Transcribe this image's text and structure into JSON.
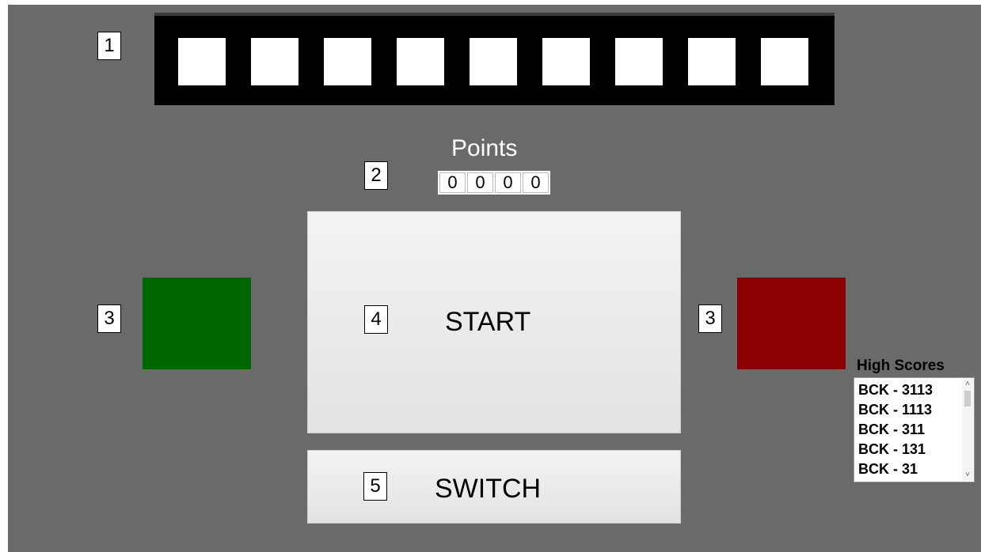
{
  "callouts": {
    "slot_strip": "1",
    "points": "2",
    "left_color": "3",
    "right_color": "3",
    "start": "4",
    "switch": "5"
  },
  "slot_strip": {
    "slot_count": 9
  },
  "points": {
    "title": "Points",
    "digits": [
      "0",
      "0",
      "0",
      "0"
    ]
  },
  "color_buttons": {
    "left": {
      "color": "#006600"
    },
    "right": {
      "color": "#8b0000"
    }
  },
  "start_button": {
    "label": "START"
  },
  "switch_button": {
    "label": "SWITCH"
  },
  "high_scores": {
    "title": "High Scores",
    "entries": [
      "BCK - 3113",
      "BCK - 1113",
      "BCK - 311",
      "BCK - 131",
      "BCK - 31"
    ],
    "scroll_up_icon": "chevron-up-icon",
    "scroll_down_icon": "chevron-down-icon"
  },
  "colors": {
    "background": "#6a6a6a",
    "strip": "#000000",
    "slot": "#ffffff",
    "button_face": "#ececec"
  }
}
